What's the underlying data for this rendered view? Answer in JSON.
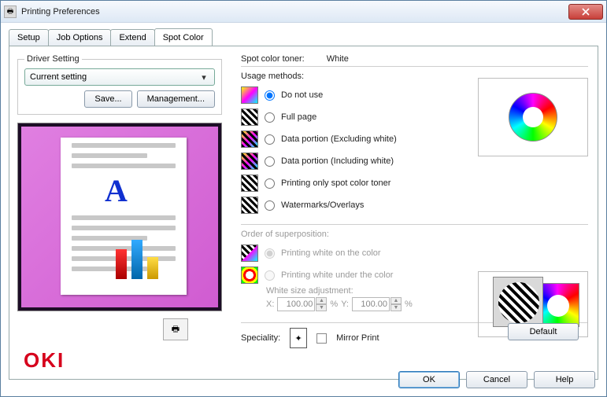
{
  "window": {
    "title": "Printing Preferences"
  },
  "tabs": {
    "setup": "Setup",
    "job_options": "Job Options",
    "extend": "Extend",
    "spot_color": "Spot Color"
  },
  "driver": {
    "legend": "Driver Setting",
    "current": "Current setting",
    "save": "Save...",
    "management": "Management..."
  },
  "preview": {
    "letter": "A"
  },
  "logo": "OKI",
  "spot": {
    "toner_label": "Spot color toner:",
    "toner_value": "White",
    "usage_label": "Usage methods:",
    "options": {
      "do_not_use": "Do not use",
      "full_page": "Full page",
      "excl_white": "Data portion (Excluding white)",
      "incl_white": "Data portion (Including white)",
      "only_spot": "Printing only spot color toner",
      "watermarks": "Watermarks/Overlays"
    },
    "order_label": "Order of superposition:",
    "order": {
      "on_color": "Printing white on the color",
      "under_color": "Printing white under the color"
    },
    "white_adj_label": "White size adjustment:",
    "x_label": "X:",
    "y_label": "Y:",
    "x_value": "100.00",
    "y_value": "100.00",
    "pct": "%",
    "speciality_label": "Speciality:",
    "mirror": "Mirror Print",
    "default": "Default"
  },
  "buttons": {
    "ok": "OK",
    "cancel": "Cancel",
    "help": "Help"
  }
}
